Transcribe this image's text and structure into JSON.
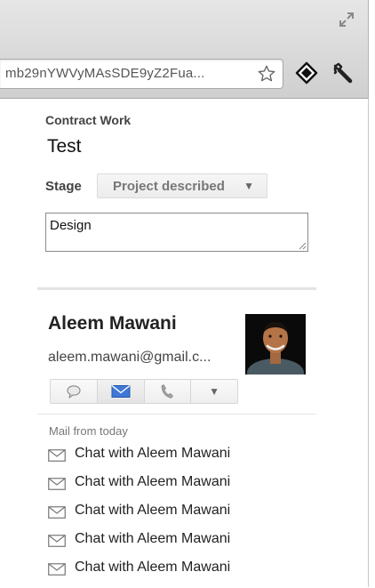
{
  "browser": {
    "address_text": "mb29nYWVyMAsSDE9yZ2Fua...",
    "icons": [
      "expand-icon",
      "star-icon",
      "extension-icon",
      "wrench-icon"
    ]
  },
  "record": {
    "section_label": "Contract Work",
    "title": "Test",
    "stage_label": "Stage",
    "stage_value": "Project described",
    "stage_caret": "▼",
    "notes": "Design"
  },
  "contact": {
    "name": "Aleem Mawani",
    "email": "aleem.mawani@gmail.c...",
    "actions": [
      {
        "icon": "chat-bubble-icon"
      },
      {
        "icon": "envelope-icon"
      },
      {
        "icon": "phone-icon"
      },
      {
        "icon": "chevron-down-icon",
        "glyph": "▼"
      }
    ]
  },
  "mail": {
    "heading": "Mail from today",
    "items": [
      "Chat with Aleem Mawani",
      "Chat with Aleem Mawani",
      "Chat with Aleem Mawani",
      "Chat with Aleem Mawani",
      "Chat with Aleem Mawani"
    ]
  },
  "colors": {
    "mail_blue": "#2e6bd1",
    "muted_gray": "#777777"
  }
}
